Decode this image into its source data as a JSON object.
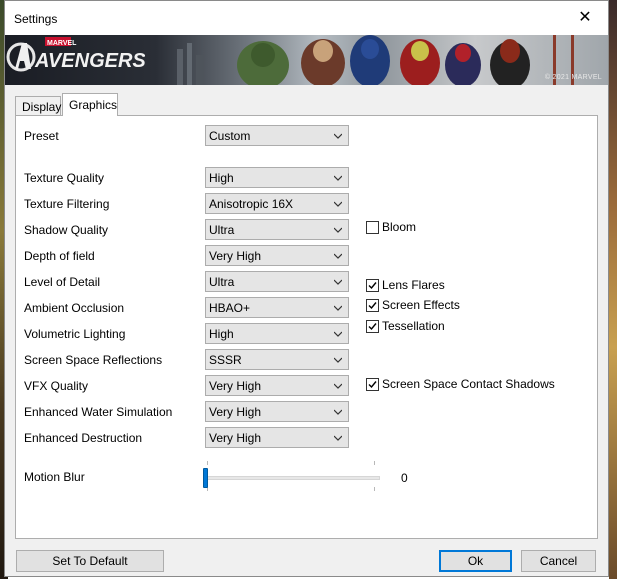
{
  "window": {
    "title": "Settings",
    "close_glyph": "✕"
  },
  "banner": {
    "logo_small": "MARVEL",
    "logo_text": "AVENGERS",
    "copyright": "© 2021 MARVEL"
  },
  "tabs": [
    {
      "label": "Display",
      "selected": false
    },
    {
      "label": "Graphics",
      "selected": true
    }
  ],
  "settings": {
    "preset": {
      "label": "Preset",
      "value": "Custom"
    },
    "rows": [
      {
        "label": "Texture Quality",
        "value": "High"
      },
      {
        "label": "Texture Filtering",
        "value": "Anisotropic 16X"
      },
      {
        "label": "Shadow Quality",
        "value": "Ultra"
      },
      {
        "label": "Depth of field",
        "value": "Very High"
      },
      {
        "label": "Level of Detail",
        "value": "Ultra"
      },
      {
        "label": "Ambient Occlusion",
        "value": "HBAO+"
      },
      {
        "label": "Volumetric Lighting",
        "value": "High"
      },
      {
        "label": "Screen Space Reflections",
        "value": "SSSR"
      },
      {
        "label": "VFX Quality",
        "value": "Very High"
      },
      {
        "label": "Enhanced Water Simulation",
        "value": "Very High"
      },
      {
        "label": "Enhanced Destruction",
        "value": "Very High"
      }
    ],
    "checkboxes": [
      {
        "label": "Bloom",
        "checked": false
      },
      {
        "label": "Lens Flares",
        "checked": true
      },
      {
        "label": "Screen Effects",
        "checked": true
      },
      {
        "label": "Tessellation",
        "checked": true
      },
      {
        "label": "Screen Space Contact Shadows",
        "checked": true
      }
    ],
    "motion_blur": {
      "label": "Motion Blur",
      "value": "0"
    }
  },
  "buttons": {
    "set_default": "Set To Default",
    "ok": "Ok",
    "cancel": "Cancel"
  },
  "colors": {
    "accent": "#0078d7",
    "dropdown_bg": "#e5e5e5",
    "window_bg": "#f0f0f0"
  }
}
